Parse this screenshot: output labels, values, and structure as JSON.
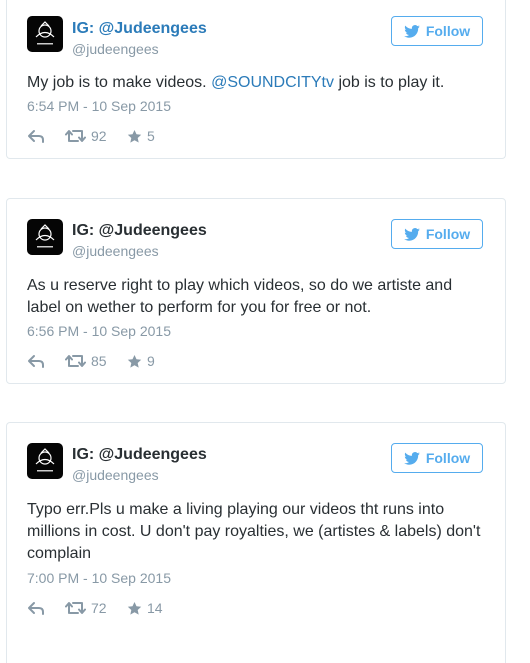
{
  "colors": {
    "link": "#2b7bb9",
    "follow": "#55acee",
    "muted": "#8899a6",
    "text": "#292f33"
  },
  "tweets": [
    {
      "display_name": "IG: @Judeengees",
      "handle": "@judeengees",
      "follow_label": "Follow",
      "text_parts": [
        "My job is to make videos. ",
        "@SOUNDCITYtv",
        " job is to play it."
      ],
      "timestamp": "6:54 PM - 10 Sep 2015",
      "retweets": "92",
      "likes": "5"
    },
    {
      "display_name": "IG: @Judeengees",
      "handle": "@judeengees",
      "follow_label": "Follow",
      "text_lines": [
        "As u reserve right to play which videos, so do we artiste and",
        "label on wether to perform for you for free or not."
      ],
      "timestamp": "6:56 PM - 10 Sep 2015",
      "retweets": "85",
      "likes": "9"
    },
    {
      "display_name": "IG: @Judeengees",
      "handle": "@judeengees",
      "follow_label": "Follow",
      "text_lines": [
        "Typo err.Pls u make a living playing our videos tht runs into",
        "millions in cost. U don't pay royalties, we (artistes & labels) don't",
        "complain"
      ],
      "timestamp": "7:00 PM - 10 Sep 2015",
      "retweets": "72",
      "likes": "14"
    }
  ]
}
